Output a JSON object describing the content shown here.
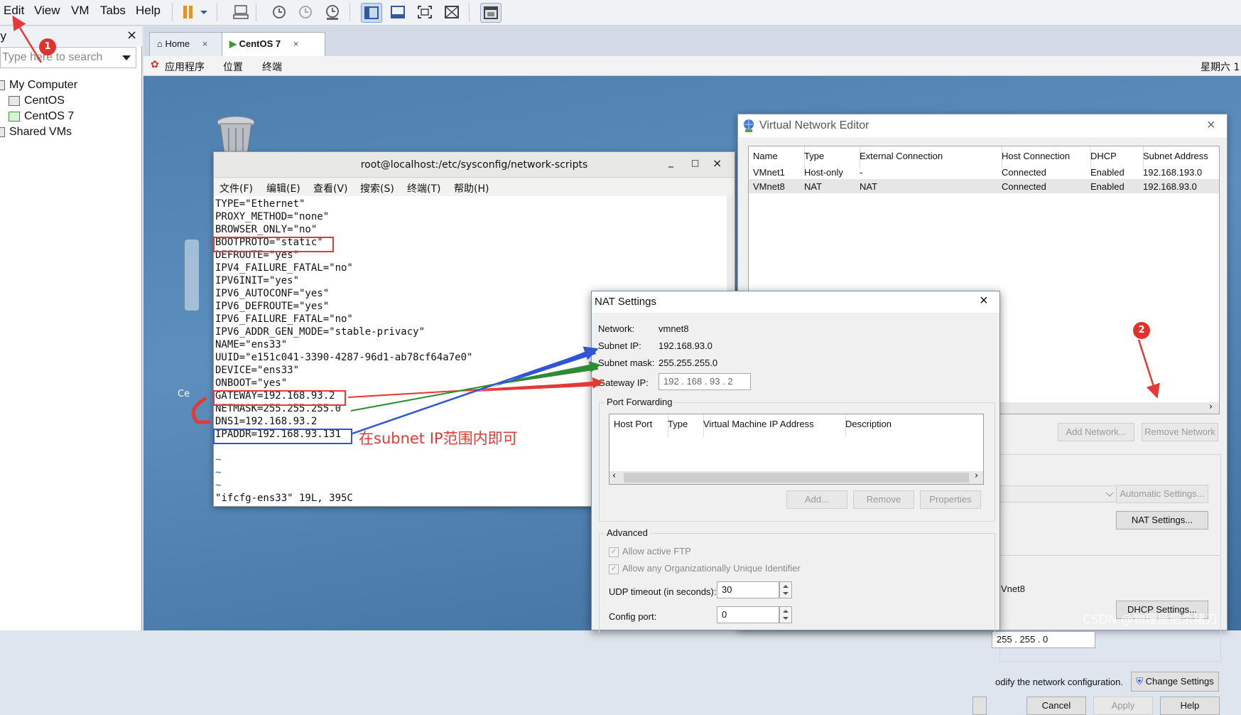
{
  "menu": {
    "edit": "Edit",
    "view": "View",
    "vm": "VM",
    "tabs": "Tabs",
    "help": "Help"
  },
  "library": {
    "title_fragment": "y",
    "close": "×",
    "search_placeholder": "Type here to search",
    "my_computer": "My Computer",
    "centos": "CentOS",
    "centos7": "CentOS 7",
    "shared": "Shared VMs"
  },
  "tabs": {
    "home": "Home",
    "centos7": "CentOS 7",
    "close": "×"
  },
  "gnome": {
    "apps": "应用程序",
    "places": "位置",
    "terminal": "终端",
    "clock": "星期六 1"
  },
  "desktop": {
    "icon_label": "Ce"
  },
  "terminal": {
    "title": "root@localhost:/etc/sysconfig/network-scripts",
    "min": "_",
    "max": "□",
    "close": "×",
    "menus": [
      "文件(F)",
      "编辑(E)",
      "查看(V)",
      "搜索(S)",
      "终端(T)",
      "帮助(H)"
    ],
    "lines": [
      "TYPE=\"Ethernet\"",
      "PROXY_METHOD=\"none\"",
      "BROWSER_ONLY=\"no\"",
      "BOOTPROTO=\"static\"",
      "DEFROUTE=\"yes\"",
      "IPV4_FAILURE_FATAL=\"no\"",
      "IPV6INIT=\"yes\"",
      "IPV6_AUTOCONF=\"yes\"",
      "IPV6_DEFROUTE=\"yes\"",
      "IPV6_FAILURE_FATAL=\"no\"",
      "IPV6_ADDR_GEN_MODE=\"stable-privacy\"",
      "NAME=\"ens33\"",
      "UUID=\"e151c041-3390-4287-96d1-ab78cf64a7e0\"",
      "DEVICE=\"ens33\"",
      "ONBOOT=\"yes\"",
      "GATEWAY=192.168.93.2",
      "NETMASK=255.255.255.0",
      "DNS1=192.168.93.2",
      "IPADDR=192.168.93.131",
      "",
      "~",
      "~",
      "~",
      "\"ifcfg-ens33\" 19L, 395C"
    ]
  },
  "vne": {
    "title": "Virtual Network Editor",
    "close": "×",
    "headers": [
      "Name",
      "Type",
      "External Connection",
      "Host Connection",
      "DHCP",
      "Subnet Address"
    ],
    "rows": [
      [
        "VMnet1",
        "Host-only",
        "-",
        "Connected",
        "Enabled",
        "192.168.193.0"
      ],
      [
        "VMnet8",
        "NAT",
        "NAT",
        "Connected",
        "Enabled",
        "192.168.93.0"
      ]
    ],
    "add_network": "Add Network...",
    "remove_network": "Remove Network",
    "automatic_settings": "Automatic Settings...",
    "nat_settings": "NAT Settings...",
    "vmnet_fragment": "Vnet8",
    "dhcp_settings": "DHCP Settings...",
    "mask_fragment": "255 . 255 .  0",
    "modify_text": "odify the network configuration.",
    "change_settings": "Change Settings",
    "cancel": "Cancel",
    "apply": "Apply",
    "help": "Help"
  },
  "nat": {
    "title": "NAT Settings",
    "close": "×",
    "network_label": "Network:",
    "network_value": "vmnet8",
    "subnet_ip_label": "Subnet IP:",
    "subnet_ip_value": "192.168.93.0",
    "subnet_mask_label": "Subnet mask:",
    "subnet_mask_value": "255.255.255.0",
    "gateway_label": "Gateway IP:",
    "gateway_value": "192 . 168 . 93  .  2",
    "port_forwarding": "Port Forwarding",
    "pf_headers": [
      "Host Port",
      "Type",
      "Virtual Machine IP Address",
      "Description"
    ],
    "add": "Add...",
    "remove": "Remove",
    "properties": "Properties",
    "advanced": "Advanced",
    "allow_ftp": "Allow active FTP",
    "allow_oui": "Allow any Organizationally Unique Identifier",
    "udp_label": "UDP timeout (in seconds):",
    "udp_value": "30",
    "config_port_label": "Config port:",
    "config_port_value": "0"
  },
  "annotation": {
    "note": "在subnet IP范围内即可",
    "badge1": "1",
    "badge2": "2",
    "colors": {
      "red": "#e53935",
      "blue": "#2f55d4",
      "green": "#2e8b32"
    }
  },
  "watermark": "CSDN @物理是把杀猪刀"
}
